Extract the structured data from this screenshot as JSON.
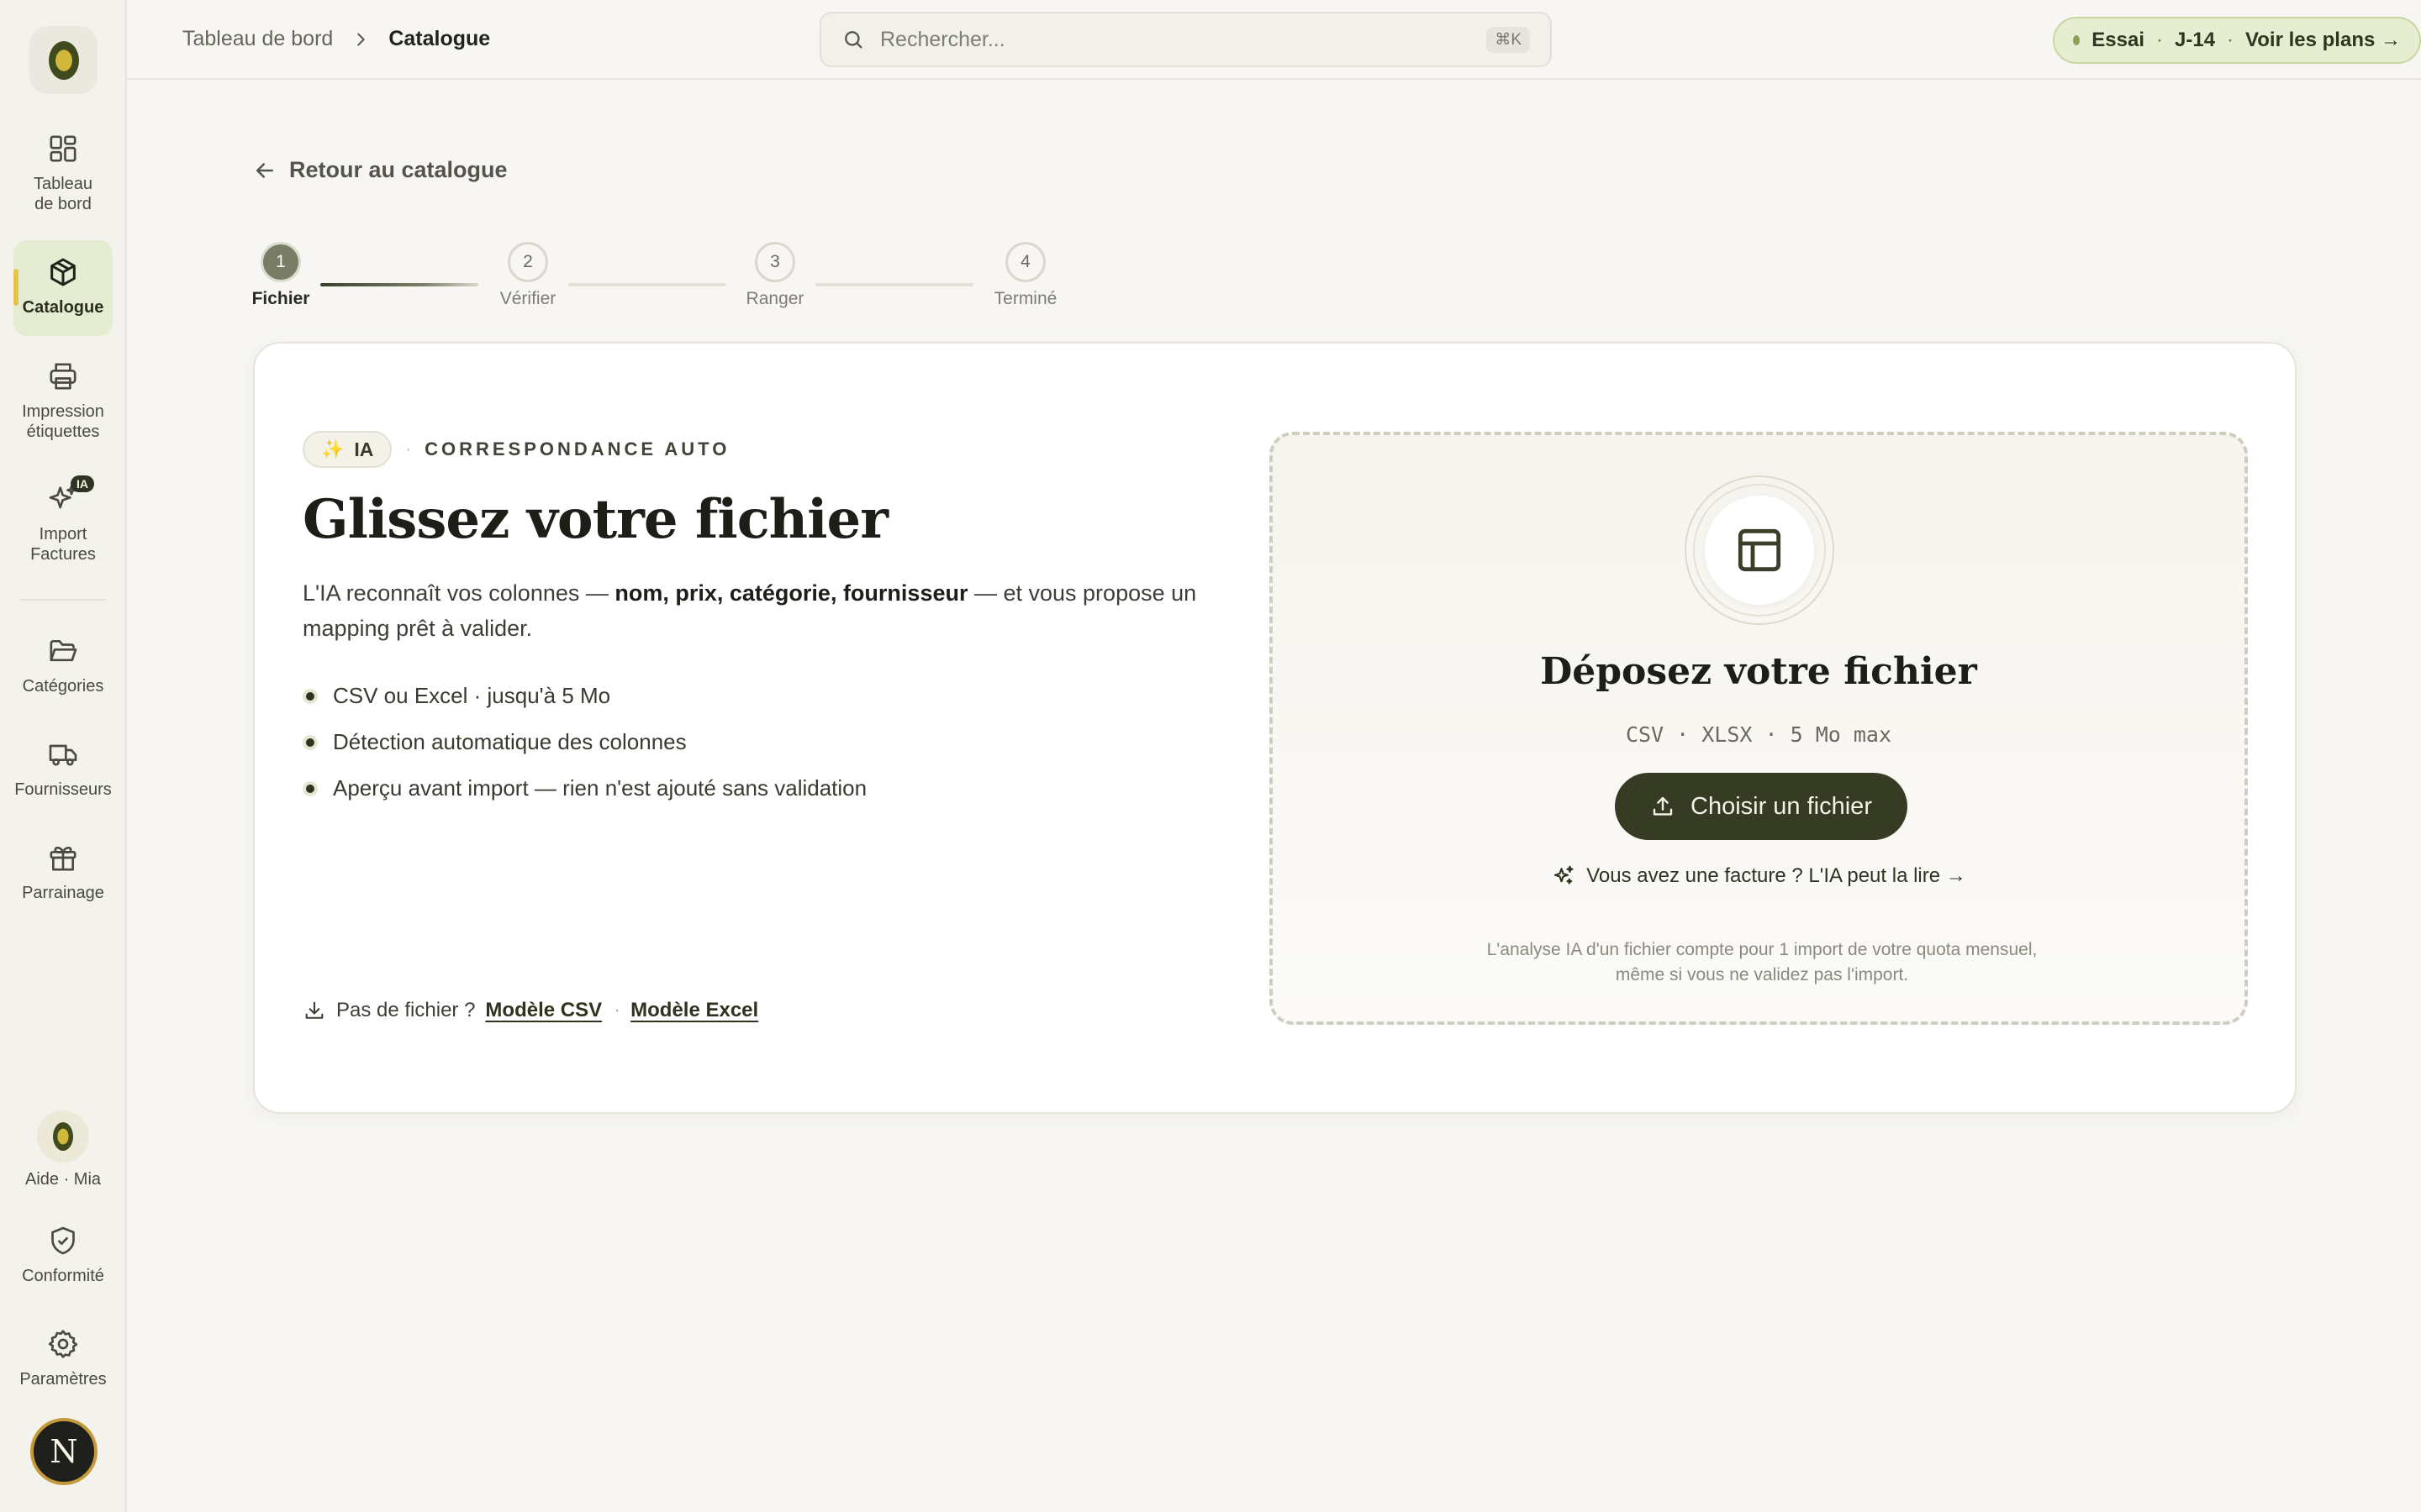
{
  "sidebar": {
    "logo": "olive-logo",
    "items": [
      {
        "label": "Tableau de bord",
        "icon": "dashboard-icon"
      },
      {
        "label": "Catalogue",
        "icon": "box-icon",
        "active": true
      },
      {
        "label": "Impression étiquettes",
        "icon": "printer-icon"
      },
      {
        "label": "Import Factures",
        "icon": "sparkles-icon",
        "badge": "IA"
      },
      {
        "label": "Catégories",
        "icon": "folder-icon"
      },
      {
        "label": "Fournisseurs",
        "icon": "truck-icon"
      },
      {
        "label": "Parrainage",
        "icon": "gift-icon"
      }
    ],
    "bottom": [
      {
        "label": "Aide · Mia",
        "icon": "olive-orb-icon"
      },
      {
        "label": "Conformité",
        "icon": "shield-check-icon"
      },
      {
        "label": "Paramètres",
        "icon": "gear-icon"
      }
    ],
    "avatar_initial": "N"
  },
  "topbar": {
    "breadcrumb": [
      "Tableau de bord",
      "Catalogue"
    ],
    "search_placeholder": "Rechercher...",
    "search_shortcut": "⌘K",
    "trial": {
      "label": "Essai",
      "days": "J-14",
      "cta": "Voir les plans →"
    }
  },
  "main": {
    "back_label": "Retour au catalogue",
    "steps": [
      {
        "num": "1",
        "label": "Fichier",
        "current": true
      },
      {
        "num": "2",
        "label": "Vérifier"
      },
      {
        "num": "3",
        "label": "Ranger"
      },
      {
        "num": "4",
        "label": "Terminé"
      }
    ],
    "card": {
      "pill": "IA",
      "pill_icon": "✨",
      "tag": "CORRESPONDANCE AUTO",
      "title": "Glissez votre fichier",
      "desc_start": "L'IA reconnaît vos colonnes — ",
      "desc_bold": "nom, prix, catégorie, fournisseur",
      "desc_end": " — et vous propose un mapping prêt à valider.",
      "bullets": [
        "CSV ou Excel · jusqu'à 5 Mo",
        "Détection automatique des colonnes",
        "Aperçu avant import — rien n'est ajouté sans validation"
      ],
      "templates": {
        "prompt": "Pas de fichier ?",
        "csv": "Modèle CSV",
        "excel": "Modèle Excel"
      }
    },
    "dropzone": {
      "title": "Déposez votre fichier",
      "formats": "CSV · XLSX · 5 Mo max",
      "button": "Choisir un fichier",
      "invoice_link": "Vous avez une facture ? L'IA peut la lire →",
      "note": "L'analyse IA d'un fichier compte pour 1 import de votre quota mensuel, même si vous ne validez pas l'import."
    }
  },
  "colors": {
    "accent": "#363b24",
    "trial_bg": "#e6edd0",
    "active_nav": "#e4ecd2",
    "indicator": "#e8c34a"
  }
}
